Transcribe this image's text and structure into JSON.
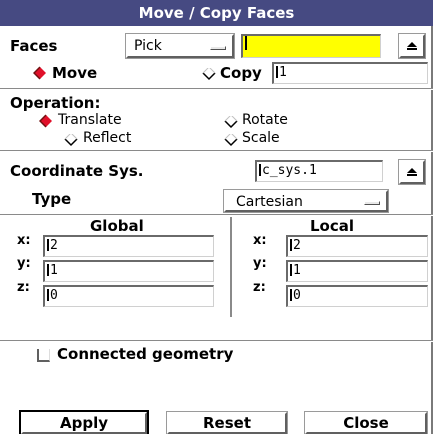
{
  "window": {
    "title": "Move / Copy Faces"
  },
  "faces": {
    "label": "Faces",
    "pick_label": "Pick",
    "field_value": ""
  },
  "mode": {
    "move_label": "Move",
    "copy_label": "Copy",
    "copy_count": "1",
    "selected": "Move"
  },
  "operation": {
    "label": "Operation:",
    "translate_label": "Translate",
    "rotate_label": "Rotate",
    "reflect_label": "Reflect",
    "scale_label": "Scale",
    "selected": "Translate"
  },
  "coord_sys": {
    "label": "Coordinate Sys.",
    "value": "c_sys.1",
    "type_label": "Type",
    "type_value": "Cartesian"
  },
  "global": {
    "header": "Global",
    "x_label": "x:",
    "x_value": "2",
    "y_label": "y:",
    "y_value": "1",
    "z_label": "z:",
    "z_value": "0"
  },
  "local": {
    "header": "Local",
    "x_label": "x:",
    "x_value": "2",
    "y_label": "y:",
    "y_value": "1",
    "z_label": "z:",
    "z_value": "0"
  },
  "connected": {
    "label": "Connected geometry",
    "checked": false
  },
  "buttons": {
    "apply": "Apply",
    "reset": "Reset",
    "close": "Close"
  },
  "colors": {
    "title_bar": "#464a82",
    "active_field": "#ffff00",
    "radio_selected": "#e0102a"
  }
}
